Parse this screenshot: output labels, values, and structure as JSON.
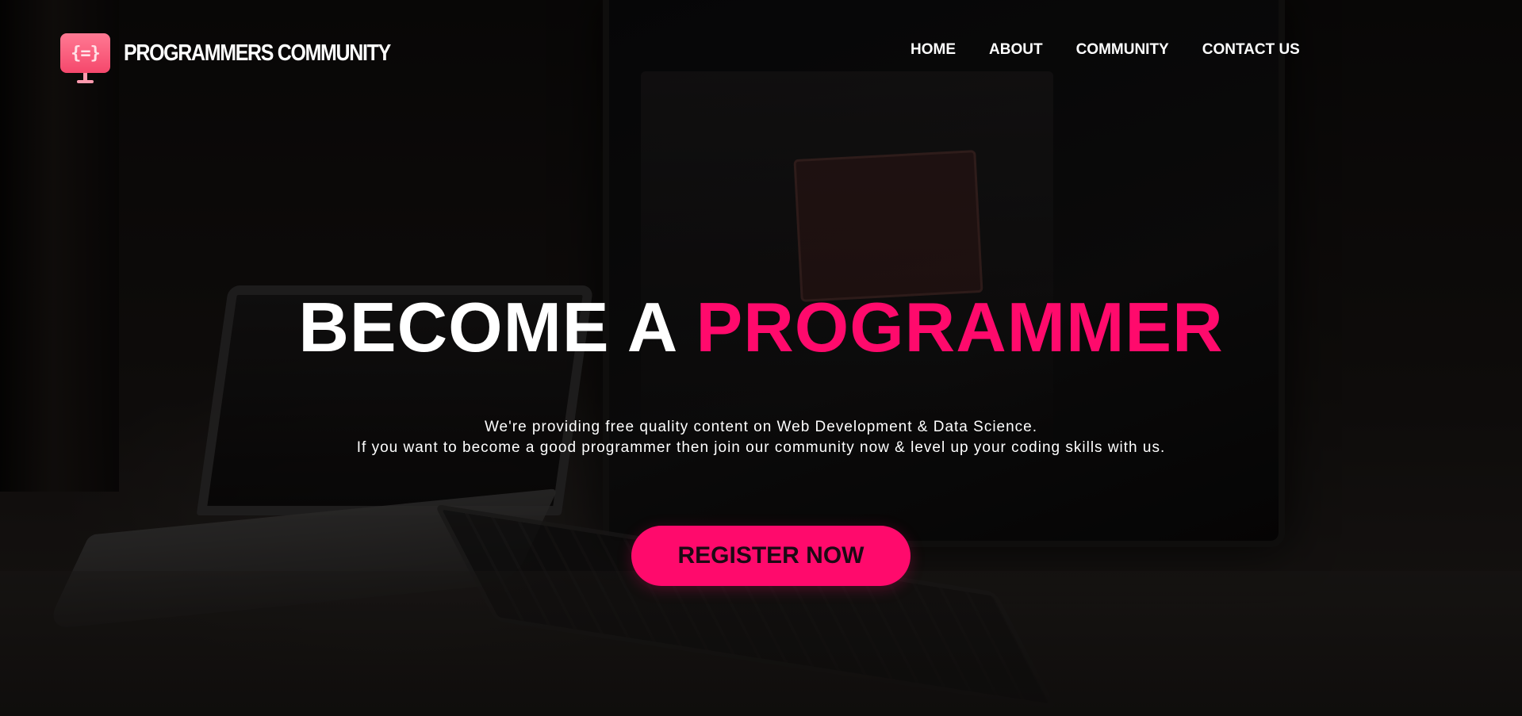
{
  "nav": {
    "brand_name": "PROGRAMMERS COMMUNITY",
    "logo_icon": "code-braces-monitor-icon",
    "logo_glyph": "{=}",
    "links": [
      {
        "label": "HOME"
      },
      {
        "label": "ABOUT"
      },
      {
        "label": "COMMUNITY"
      },
      {
        "label": "CONTACT US"
      }
    ]
  },
  "hero": {
    "headline_part1": "BECOME A",
    "headline_part2": "PROGRAMMER",
    "subtext_line1": "We're providing free quality content on Web Development & Data Science.",
    "subtext_line2": "If you want to become a good programmer then join our community now & level up your coding skills with us.",
    "cta_label": "REGISTER NOW"
  },
  "colors": {
    "accent": "#ff0a6c",
    "logo_pink": "#f5486c",
    "text": "#ffffff",
    "background": "#0b0908"
  }
}
